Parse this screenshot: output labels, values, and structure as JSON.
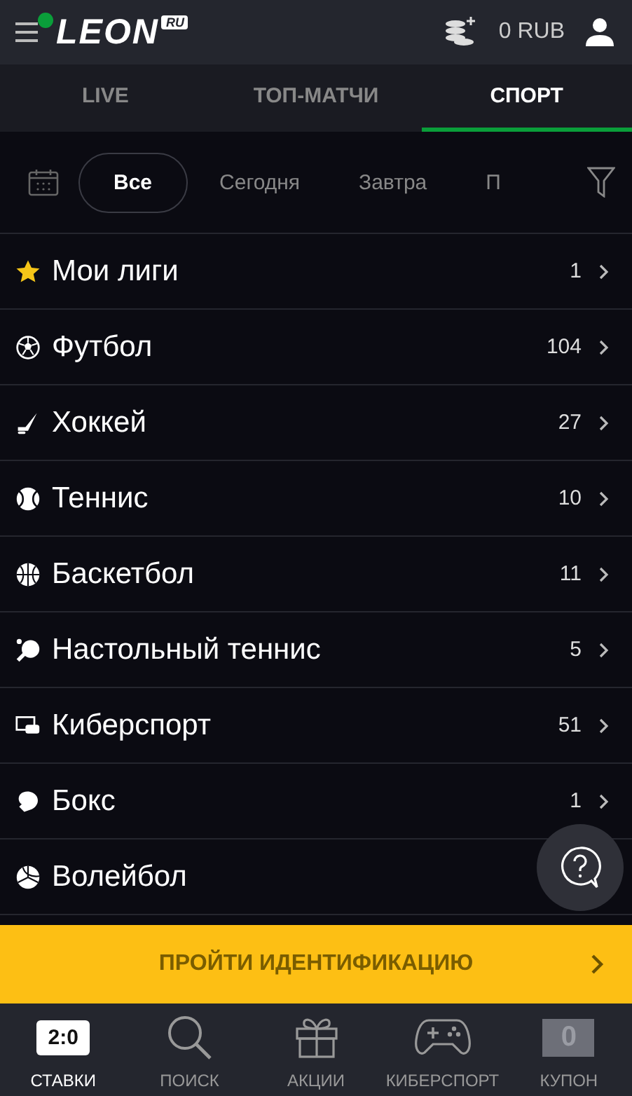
{
  "header": {
    "logo": "LEON",
    "logo_badge": "RU",
    "notification": true,
    "balance": "0 RUB"
  },
  "tabs": [
    {
      "label": "LIVE",
      "selected": false
    },
    {
      "label": "ТОП-МАТЧИ",
      "selected": false
    },
    {
      "label": "СПОРТ",
      "selected": true
    }
  ],
  "date_filter": [
    {
      "label": "Все",
      "selected": true
    },
    {
      "label": "Сегодня",
      "selected": false
    },
    {
      "label": "Завтра",
      "selected": false
    },
    {
      "label": "П",
      "selected": false
    }
  ],
  "sports": [
    {
      "kind": "star",
      "name": "Мои лиги",
      "count": "1"
    },
    {
      "kind": "football",
      "name": "Футбол",
      "count": "104"
    },
    {
      "kind": "hockey",
      "name": "Хоккей",
      "count": "27"
    },
    {
      "kind": "tennis",
      "name": "Теннис",
      "count": "10"
    },
    {
      "kind": "basketball",
      "name": "Баскетбол",
      "count": "11"
    },
    {
      "kind": "pingpong",
      "name": "Настольный теннис",
      "count": "5"
    },
    {
      "kind": "esport",
      "name": "Киберспорт",
      "count": "51"
    },
    {
      "kind": "boxing",
      "name": "Бокс",
      "count": "1"
    },
    {
      "kind": "volleyball",
      "name": "Волейбол"
    }
  ],
  "banner": {
    "label": "ПРОЙТИ ИДЕНТИФИКАЦИЮ"
  },
  "bottom_nav": [
    {
      "kind": "score",
      "badge": "2:0",
      "label": "СТАВКИ",
      "selected": true
    },
    {
      "kind": "search",
      "label": "ПОИСК",
      "selected": false
    },
    {
      "kind": "gift",
      "label": "АКЦИИ",
      "selected": false
    },
    {
      "kind": "gamepad",
      "label": "КИБЕРСПОРТ",
      "selected": false
    },
    {
      "kind": "coupon",
      "badge": "0",
      "label": "КУПОН",
      "selected": false
    }
  ]
}
